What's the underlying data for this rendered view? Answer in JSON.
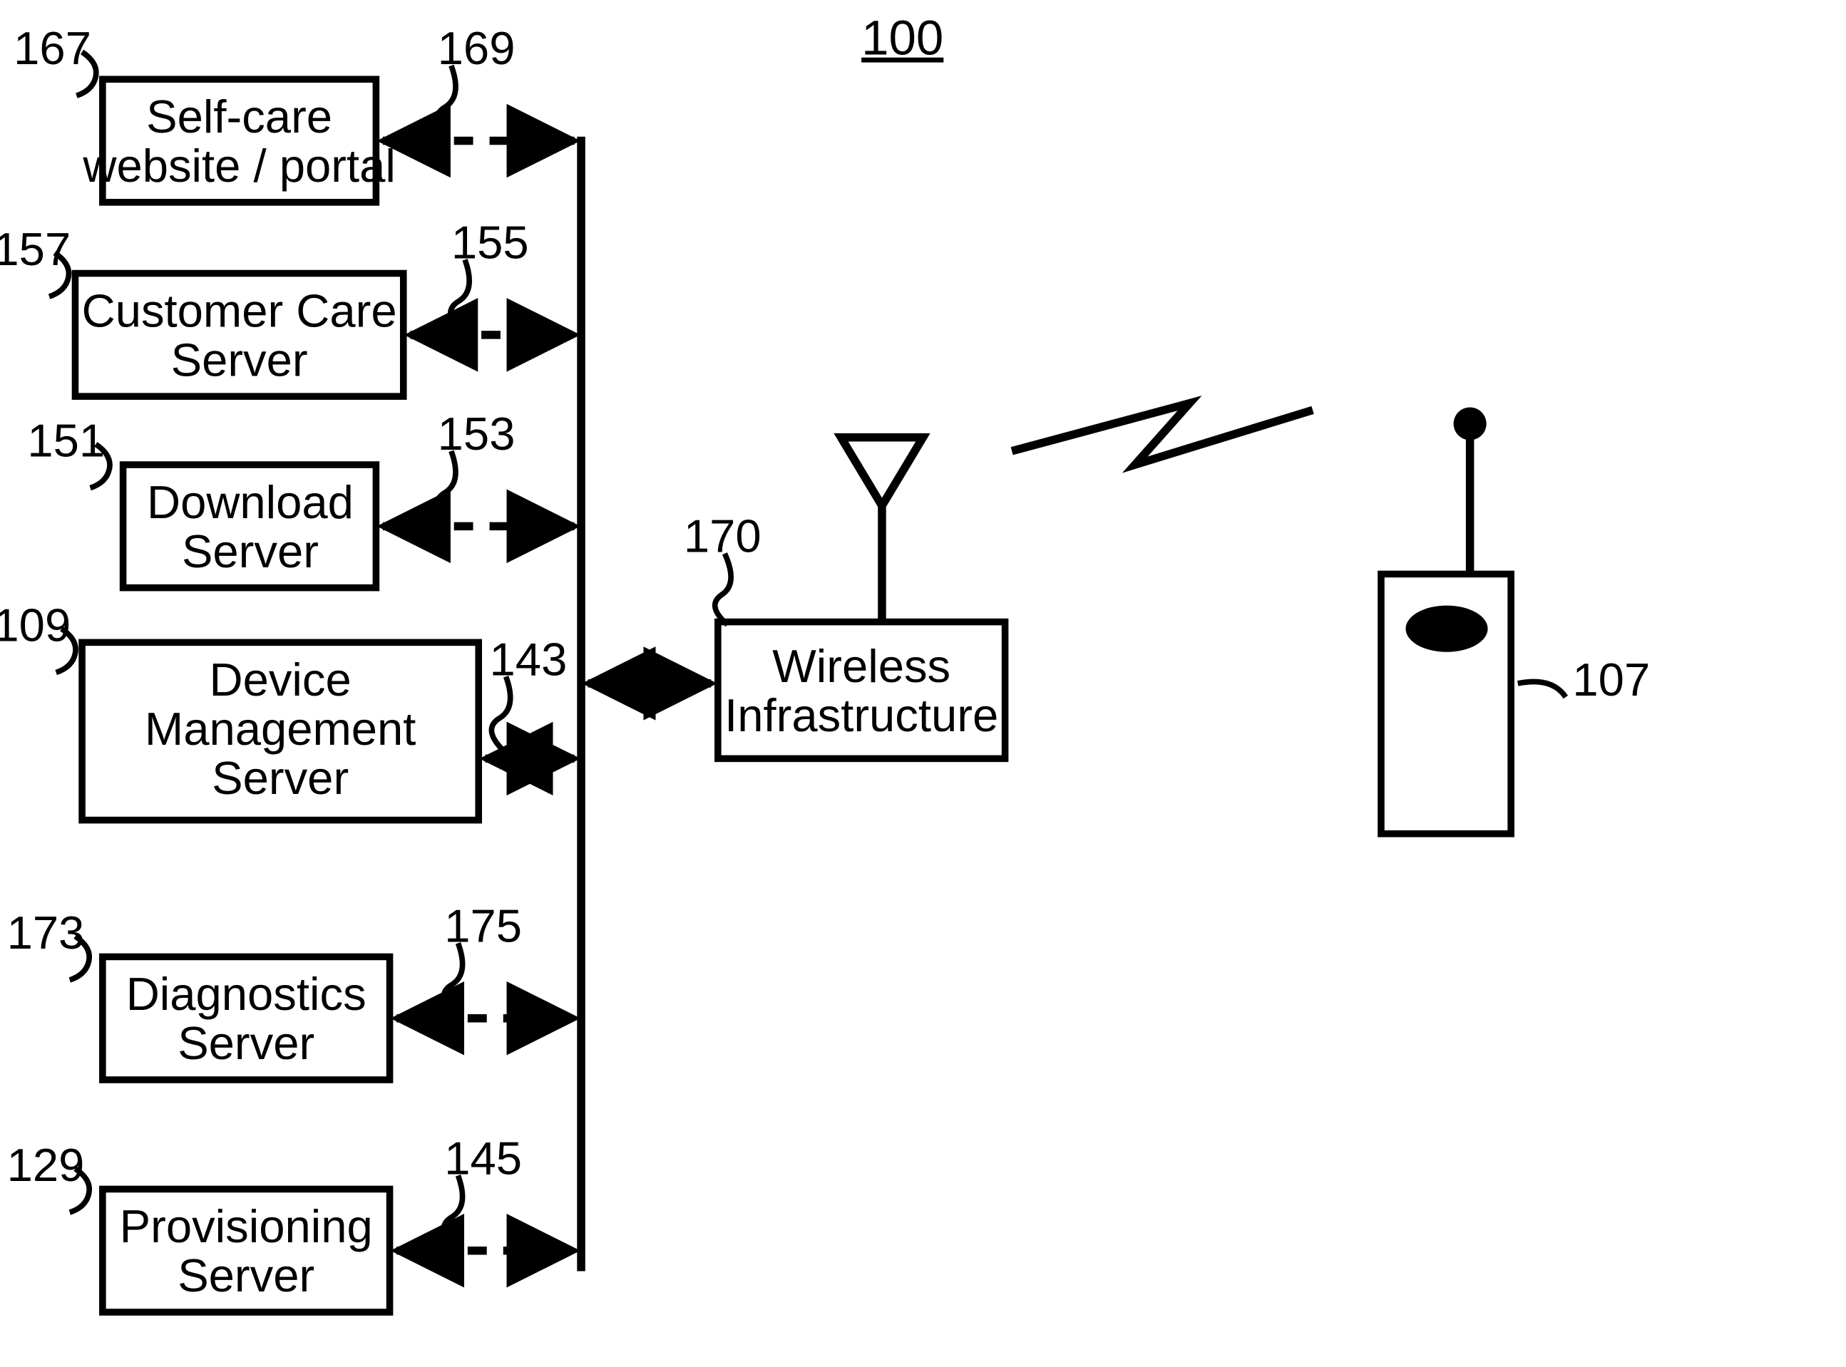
{
  "title": "100",
  "boxes": {
    "selfcare": {
      "ref": "167",
      "connref": "169",
      "line1": "Self-care",
      "line2": "website / portal"
    },
    "custcare": {
      "ref": "157",
      "connref": "155",
      "line1": "Customer Care",
      "line2": "Server"
    },
    "download": {
      "ref": "151",
      "connref": "153",
      "line1": "Download",
      "line2": "Server"
    },
    "devmgmt": {
      "ref": "109",
      "connref": "143",
      "line1": "Device",
      "line2": "Management",
      "line3": "Server"
    },
    "diag": {
      "ref": "173",
      "connref": "175",
      "line1": "Diagnostics",
      "line2": "Server"
    },
    "prov": {
      "ref": "129",
      "connref": "145",
      "line1": "Provisioning",
      "line2": "Server"
    }
  },
  "wireless": {
    "ref": "170",
    "line1": "Wireless",
    "line2": "Infrastructure"
  },
  "device": {
    "ref": "107"
  }
}
